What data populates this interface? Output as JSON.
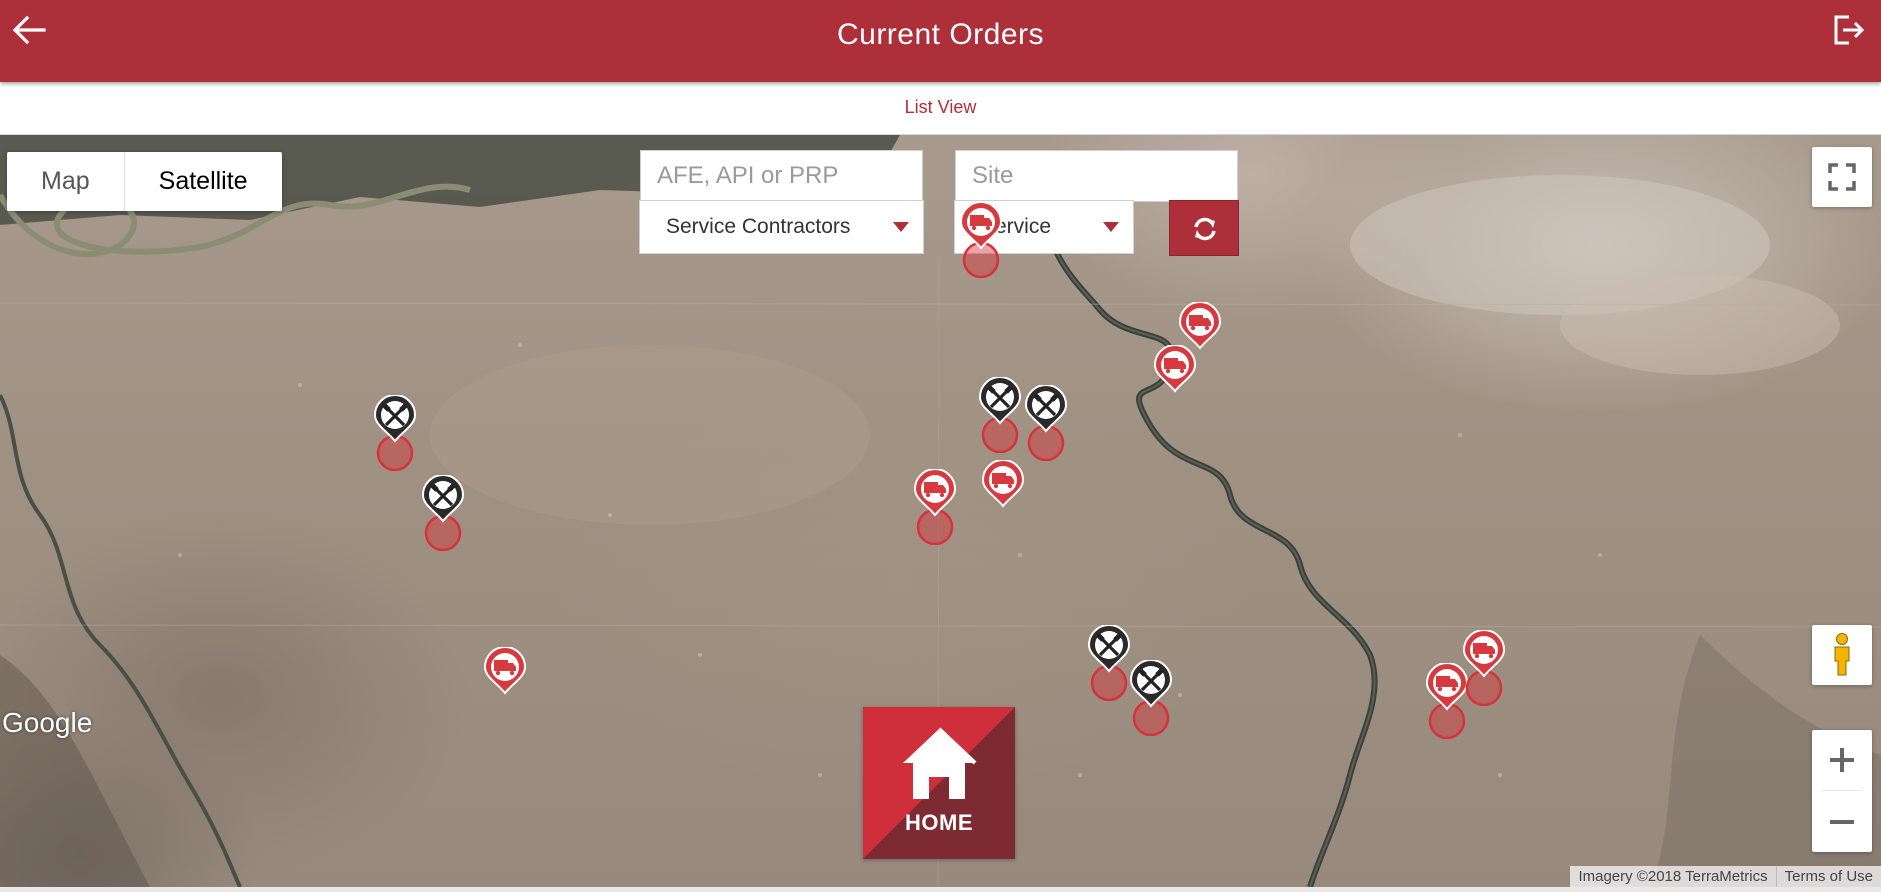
{
  "header": {
    "title": "Current Orders",
    "back_icon": "back-arrow-icon",
    "logout_icon": "logout-icon",
    "background": "#ad2f3a"
  },
  "subheader": {
    "list_view_label": "List View"
  },
  "map": {
    "type_control": {
      "options": [
        "Map",
        "Satellite"
      ],
      "selected": "Satellite"
    },
    "search": {
      "afe_placeholder": "AFE, API or PRP",
      "site_placeholder": "Site"
    },
    "filters": {
      "contractor_selected": "Service Contractors",
      "service_selected": "Service"
    },
    "refresh_icon": "refresh-icon",
    "home_label": "HOME",
    "google_logo": "Google",
    "attribution": "Imagery ©2018 TerraMetrics",
    "terms_label": "Terms of Use",
    "marker_colors": {
      "service": "#d63a3f",
      "contractor": "#2a2a2a",
      "zone": "#d6323a"
    }
  }
}
